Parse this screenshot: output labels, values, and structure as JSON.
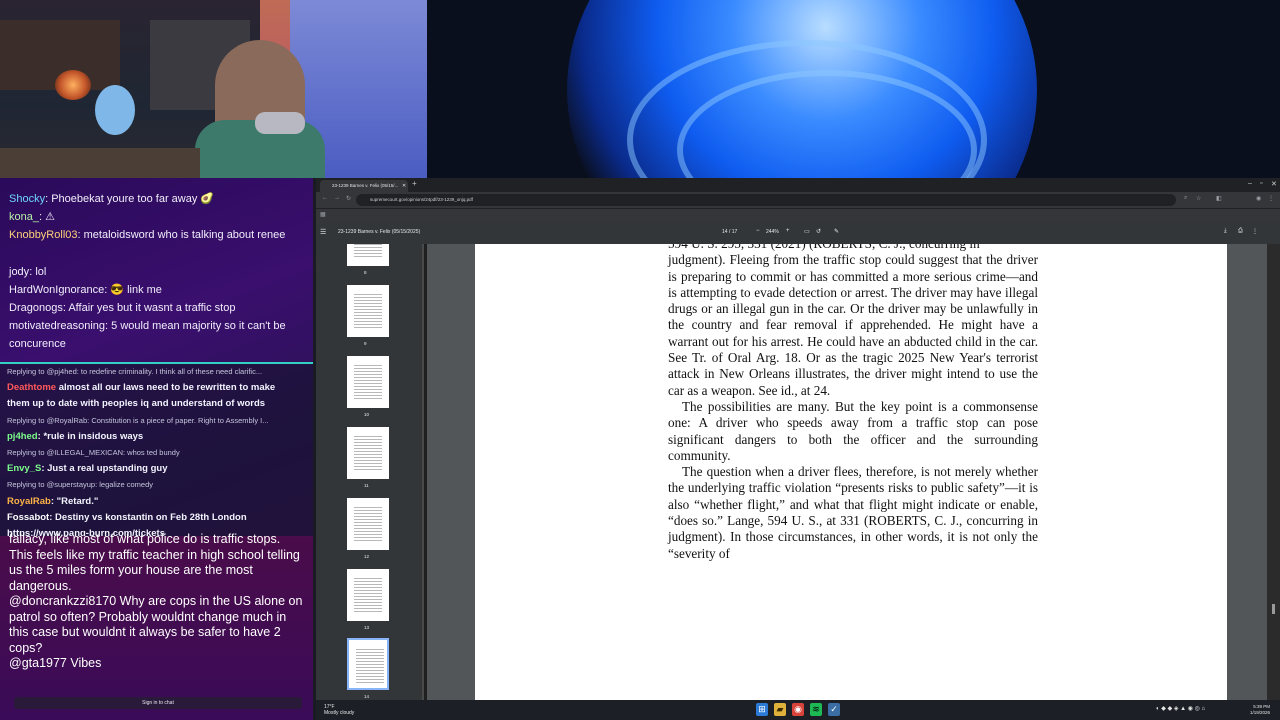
{
  "chat": {
    "messages": [
      {
        "user": "Shocky",
        "user_color": "#6fd6ff",
        "text": "Phoebekat youre too far away 🥑"
      },
      {
        "user": "kona_",
        "user_color": "#b6f0a6",
        "text": "⚠"
      },
      {
        "user": "KnobbyRoll03",
        "user_color": "#ffd27a",
        "text": "metaloidsword who is talking about renee"
      },
      {
        "user": "jody",
        "user_color": "#f1eefb",
        "text": "lol"
      },
      {
        "user": "HardWonIgnorance",
        "user_color": "#f1eefb",
        "text": "😎 link me"
      },
      {
        "user": "Dragonogs",
        "user_color": "#f1eefb",
        "text": "Affair yes but it wasnt a traffic stop"
      },
      {
        "user": "motivatedreasoning",
        "user_color": "#f1eefb",
        "text": "5 would mean majority so it can't be"
      },
      {
        "user": "",
        "user_color": "#f1eefb",
        "text": "concurence"
      }
    ],
    "strip": [
      {
        "reply": "Replying to @pj4hed: to redefine criminality. I think all of these need clarific..."
      },
      {
        "user": "Deathtome",
        "user_color": "#ff5a5a",
        "text": "almost all our laws need to be rewritten to make"
      },
      {
        "user": "",
        "text": "them up to date with peoples iq and understand of words"
      },
      {
        "reply": "Replying to @RoyalRab: Constitution is a piece of paper. Right to Assembly I..."
      },
      {
        "user": "pj4hed",
        "user_color": "#7cfc8a",
        "text": "*rule in insidous ways"
      },
      {
        "reply": "Replying to @ILLEGAL_MEXICAN: whos ted bundy"
      },
      {
        "user": "Envy_S",
        "user_color": "#7cfc8a",
        "text": "Just a real upstanding guy"
      },
      {
        "reply": "Replying to @superstayup: legalize comedy"
      },
      {
        "user": "RoyalRab",
        "user_color": "#ffb347",
        "text": "\"Retard.\""
      },
      {
        "user": "Fossabot",
        "user_color": "#ffffff",
        "text": "Destiny vs konstantin on Feb 28th London"
      },
      {
        "user": "",
        "text": "https://www.pang-burn.com/tickets"
      }
    ],
    "lower": [
      "fallacy, like most of what police do is traffic stops. This feels like my traffic teacher in high school telling us the 5 miles form your house are the most dangerous.",
      "@doncrankzzi8170 Why are cops in the US alone on patrol so often? Probably wouldnt change much in this case but wouldnt it always be safer to have 2 cops?",
      "@gta1977 Vibes"
    ],
    "signin": "Sign in to chat"
  },
  "browser": {
    "tab_title": "23-1239 Barnes v. Felix (05/15/...",
    "new_tab": "+",
    "url": "supremecourt.gov/opinions/24pdf/23-1239_onjq.pdf",
    "pdf_title": "23-1239 Barnes v. Felix (05/15/2025)",
    "page_indicator": "14 / 17",
    "zoom": "244%",
    "thumbs": [
      "8",
      "9",
      "10",
      "11",
      "12",
      "13",
      "14"
    ],
    "active_thumb": "14"
  },
  "document": {
    "top_line": "594 U. S. 295, 331 (2021) (ROBERTS, C. J., concurring in",
    "paragraphs": [
      "judgment).  Fleeing from the traffic stop could suggest that the driver is preparing to commit or has committed a more serious crime—and is attempting to evade detection or arrest.  The driver may have illegal drugs or an illegal gun in the car.  Or the driver may be unlawfully in the country and fear removal if apprehended.  He might have a warrant out for his arrest.  He could have an abducted child in the car.  See Tr. of Oral Arg. 18.  Or as the tragic 2025 New Year's terrorist attack in New Orleans illustrates, the driver might intend to use the car as a weapon.  See id., at 24.",
      "The possibilities are many.  But the key point is a commonsense one: A driver who speeds away from a traffic stop can pose significant dangers to both the officer and the surrounding community.",
      "The question when a driver flees, therefore, is not merely whether the underlying traffic violation “presents risks to public safety”—it is also “whether flight,” and what that flight might indicate or enable, “does so.”  Lange, 594 U. S., at 331 (ROBERTS, C. J., concurring in judgment).  In those circumstances, in other words, it is not only the “severity of"
    ]
  },
  "taskbar": {
    "weather_temp": "17°F",
    "weather_desc": "Mostly cloudy",
    "time": "5:39 PM",
    "date": "1/19/2026"
  }
}
